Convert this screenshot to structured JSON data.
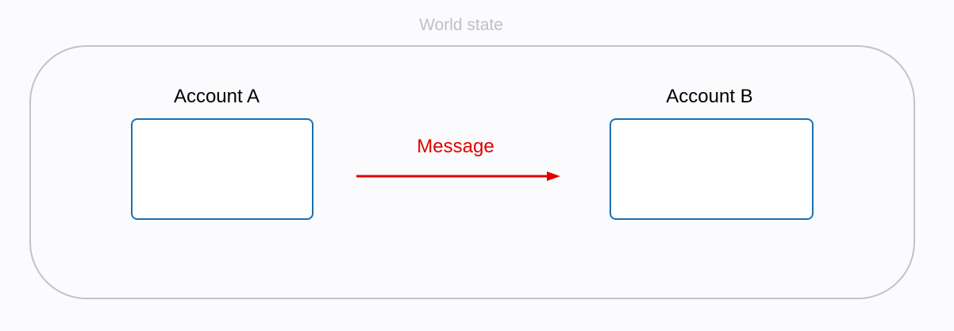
{
  "world": {
    "title": "World state",
    "title_color": "#c0c0c4",
    "frame_color": "#c3c3c6"
  },
  "account_a": {
    "label": "Account A"
  },
  "account_b": {
    "label": "Account B"
  },
  "account_box_color": "#1a6fb5",
  "message": {
    "label": "Message",
    "color": "#e00000"
  }
}
